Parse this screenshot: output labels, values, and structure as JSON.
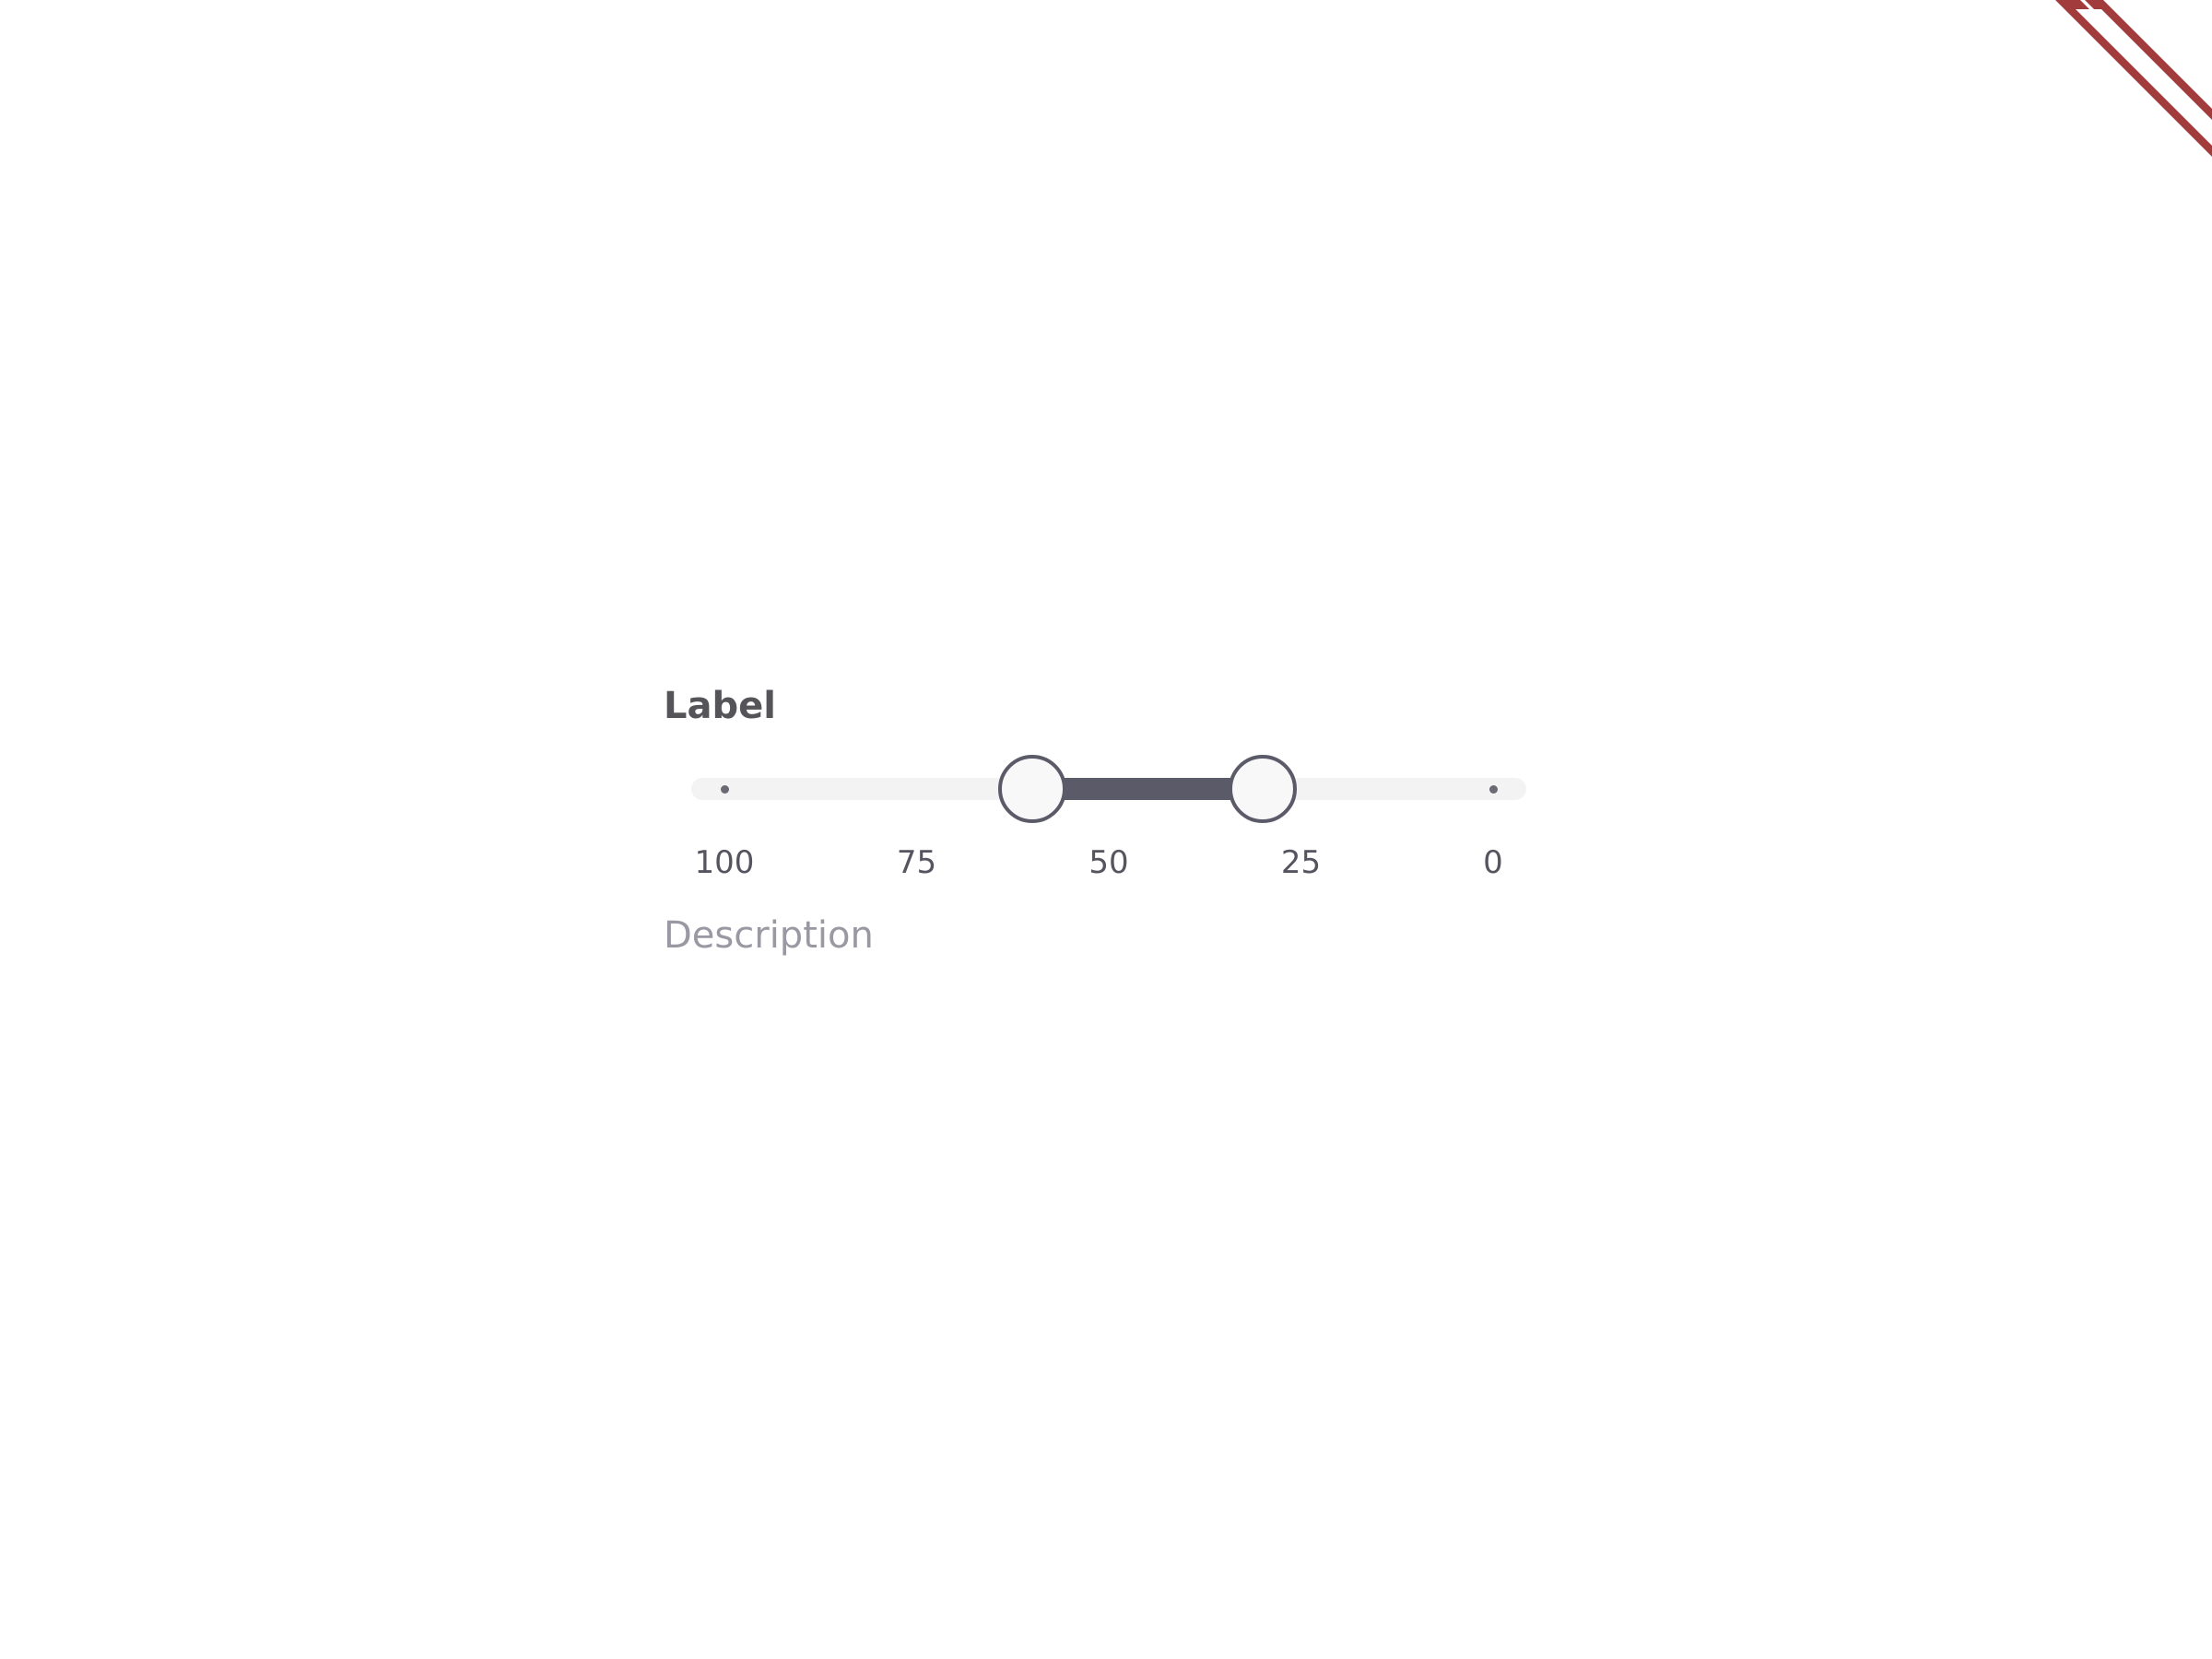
{
  "field": {
    "label": "Label",
    "description": "Description"
  },
  "slider": {
    "min": 0,
    "max": 100,
    "reversed": true,
    "values": [
      60,
      30
    ],
    "ticks": [
      "100",
      "75",
      "50",
      "25",
      "0"
    ],
    "colors": {
      "track": "#f3f3f4",
      "range": "#5b5a68",
      "thumb_fill": "#f8f8f9",
      "thumb_border": "#5b5a68"
    }
  },
  "corner_ribbon": {
    "color": "#a23b3b"
  }
}
